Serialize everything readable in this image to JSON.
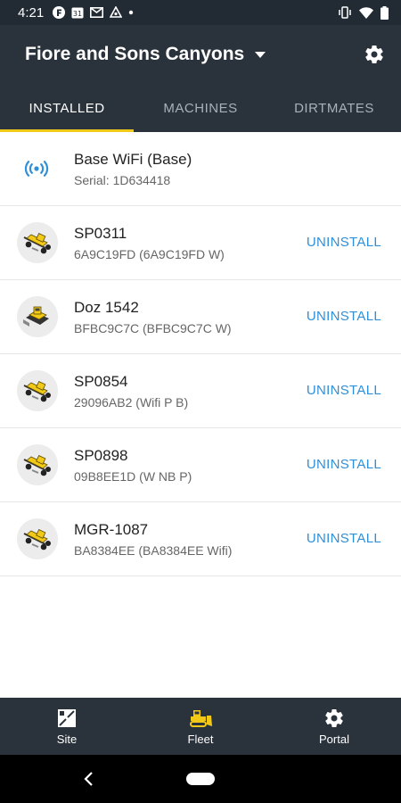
{
  "status_bar": {
    "time": "4:21",
    "icons": [
      "f-app-icon",
      "calendar-31-icon",
      "gmail-icon",
      "sync-icon",
      "dot-icon",
      "vibrate-icon",
      "wifi-signal-icon",
      "battery-icon"
    ]
  },
  "app_bar": {
    "title": "Fiore and Sons Canyons",
    "dropdown_icon": "caret-down-icon",
    "settings_icon": "gear-icon"
  },
  "tabs": [
    {
      "label": "INSTALLED",
      "active": true
    },
    {
      "label": "MACHINES",
      "active": false
    },
    {
      "label": "DIRTMATES",
      "active": false
    }
  ],
  "colors": {
    "app_bar": "#2a323b",
    "status_bar": "#222a33",
    "accent_yellow": "#f3c917",
    "link_blue": "#2f8fd8"
  },
  "list": [
    {
      "icon": "wifi-base-icon",
      "title": "Base WiFi (Base)",
      "subtitle": "Serial: 1D634418",
      "action": ""
    },
    {
      "icon": "motor-grader-icon",
      "title": "SP0311",
      "subtitle": "6A9C19FD (6A9C19FD W)",
      "action": "UNINSTALL"
    },
    {
      "icon": "dozer-icon",
      "title": "Doz 1542",
      "subtitle": "BFBC9C7C (BFBC9C7C W)",
      "action": "UNINSTALL"
    },
    {
      "icon": "motor-grader-icon",
      "title": "SP0854",
      "subtitle": "29096AB2 (Wifi P B)",
      "action": "UNINSTALL"
    },
    {
      "icon": "motor-grader-icon",
      "title": "SP0898",
      "subtitle": "09B8EE1D (W NB P)",
      "action": "UNINSTALL"
    },
    {
      "icon": "motor-grader-icon",
      "title": "MGR-1087",
      "subtitle": "BA8384EE (BA8384EE Wifi)",
      "action": "UNINSTALL"
    }
  ],
  "bottom_nav": [
    {
      "label": "Site",
      "icon": "site-map-icon"
    },
    {
      "label": "Fleet",
      "icon": "bulldozer-icon"
    },
    {
      "label": "Portal",
      "icon": "gear-icon"
    }
  ],
  "system_nav": {
    "back_icon": "back-chevron-icon",
    "home_icon": "home-pill-icon"
  }
}
